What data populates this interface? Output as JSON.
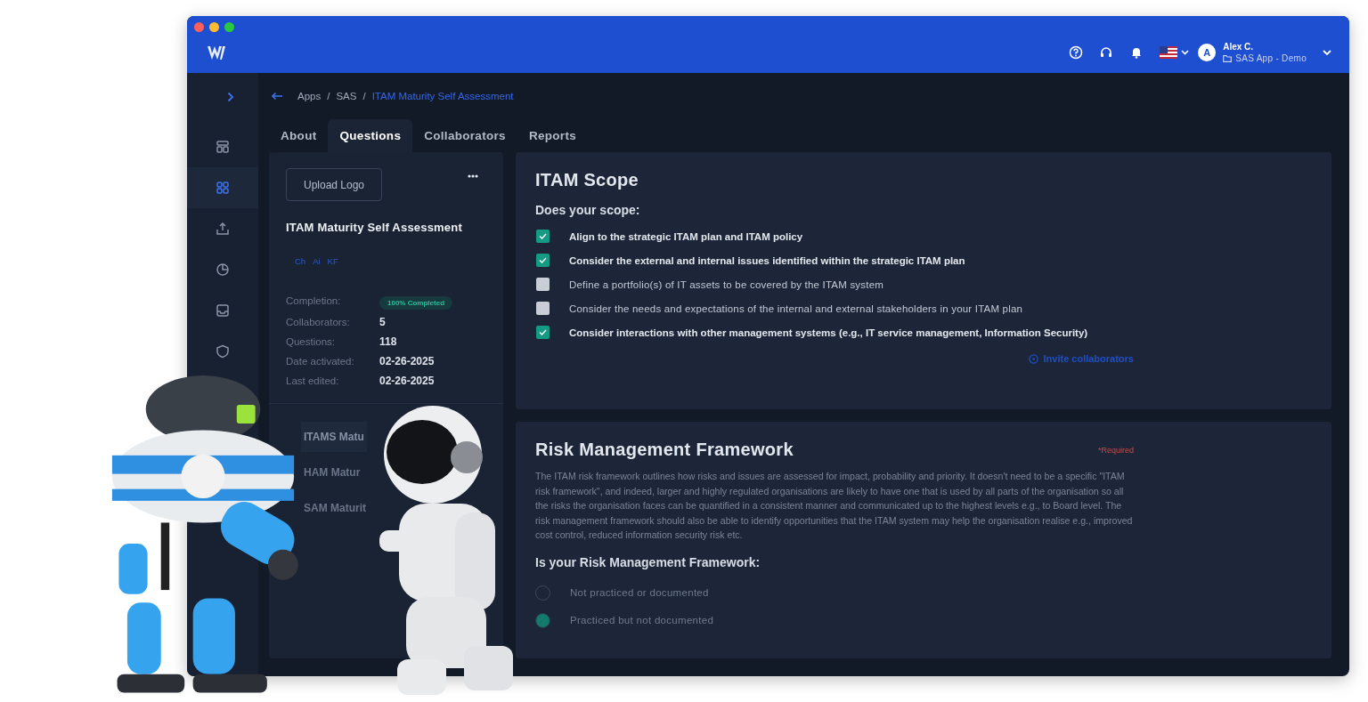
{
  "header": {
    "user": {
      "initial": "A",
      "name": "Alex C.",
      "workspace": "SAS App - Demo"
    }
  },
  "sidebar": {
    "items": [
      {
        "kind": "layout",
        "selected": false
      },
      {
        "kind": "grid",
        "selected": true
      },
      {
        "kind": "upload",
        "selected": false
      },
      {
        "kind": "chart",
        "selected": false
      },
      {
        "kind": "inbox",
        "selected": false
      },
      {
        "kind": "shield",
        "selected": false
      }
    ]
  },
  "breadcrumb": {
    "separator": "/",
    "items": [
      {
        "label": "Apps",
        "current": false
      },
      {
        "label": "SAS",
        "current": false
      },
      {
        "label": "ITAM Maturity Self Assessment",
        "current": true
      }
    ]
  },
  "tabs": [
    {
      "label": "About",
      "selected": false
    },
    {
      "label": "Questions",
      "selected": true
    },
    {
      "label": "Collaborators",
      "selected": false
    },
    {
      "label": "Reports",
      "selected": false
    }
  ],
  "assessment": {
    "upload_button": "Upload Logo",
    "title": "ITAM Maturity Self Assessment",
    "tags": [
      "Ch",
      "Ai",
      "KF"
    ],
    "stats": [
      {
        "label": "Completion:",
        "value": "100% Completed",
        "kind": "badge"
      },
      {
        "label": "Collaborators:",
        "value": "5",
        "kind": "text"
      },
      {
        "label": "Questions:",
        "value": "118",
        "kind": "text"
      },
      {
        "label": "Date activated:",
        "value": "02-26-2025",
        "kind": "text"
      },
      {
        "label": "Last edited:",
        "value": "02-26-2025",
        "kind": "text"
      }
    ],
    "sections": [
      {
        "label": "ITAMS Matu",
        "selected": true
      },
      {
        "label": "HAM Matur",
        "selected": false
      },
      {
        "label": "SAM Maturit",
        "selected": false
      }
    ]
  },
  "scope": {
    "title": "ITAM Scope",
    "question": "Does your scope:",
    "items": [
      {
        "label": "Align to the strategic ITAM plan and ITAM policy",
        "checked": true
      },
      {
        "label": "Consider the external and internal issues identified within the strategic ITAM plan",
        "checked": true
      },
      {
        "label": "Define a portfolio(s) of IT assets to be covered by the ITAM system",
        "checked": false
      },
      {
        "label": "Consider the needs and expectations of the internal and external stakeholders in your ITAM plan",
        "checked": false
      },
      {
        "label": "Consider interactions with other management systems (e.g., IT service management, Information Security)",
        "checked": true
      }
    ],
    "invite_link": "Invite collaborators"
  },
  "risk": {
    "title": "Risk Management Framework",
    "required": "*Required",
    "description": "The ITAM risk framework outlines how risks and issues are assessed for impact, probability and priority. It doesn't need to be a specific \"ITAM risk framework\", and indeed, larger and highly regulated organisations are likely to have one that is used by all parts of the organisation so all the risks the organisation faces can be quantified in a consistent manner and communicated up to the highest levels e.g., to Board level. The risk management framework should also be able to identify opportunities that the ITAM system may help the organisation realise e.g., improved cost control, reduced information security risk etc.",
    "question": "Is your Risk Management Framework:",
    "options": [
      {
        "label": "Not practiced or documented",
        "selected": false
      },
      {
        "label": "Practiced but not documented",
        "selected": true
      }
    ]
  }
}
